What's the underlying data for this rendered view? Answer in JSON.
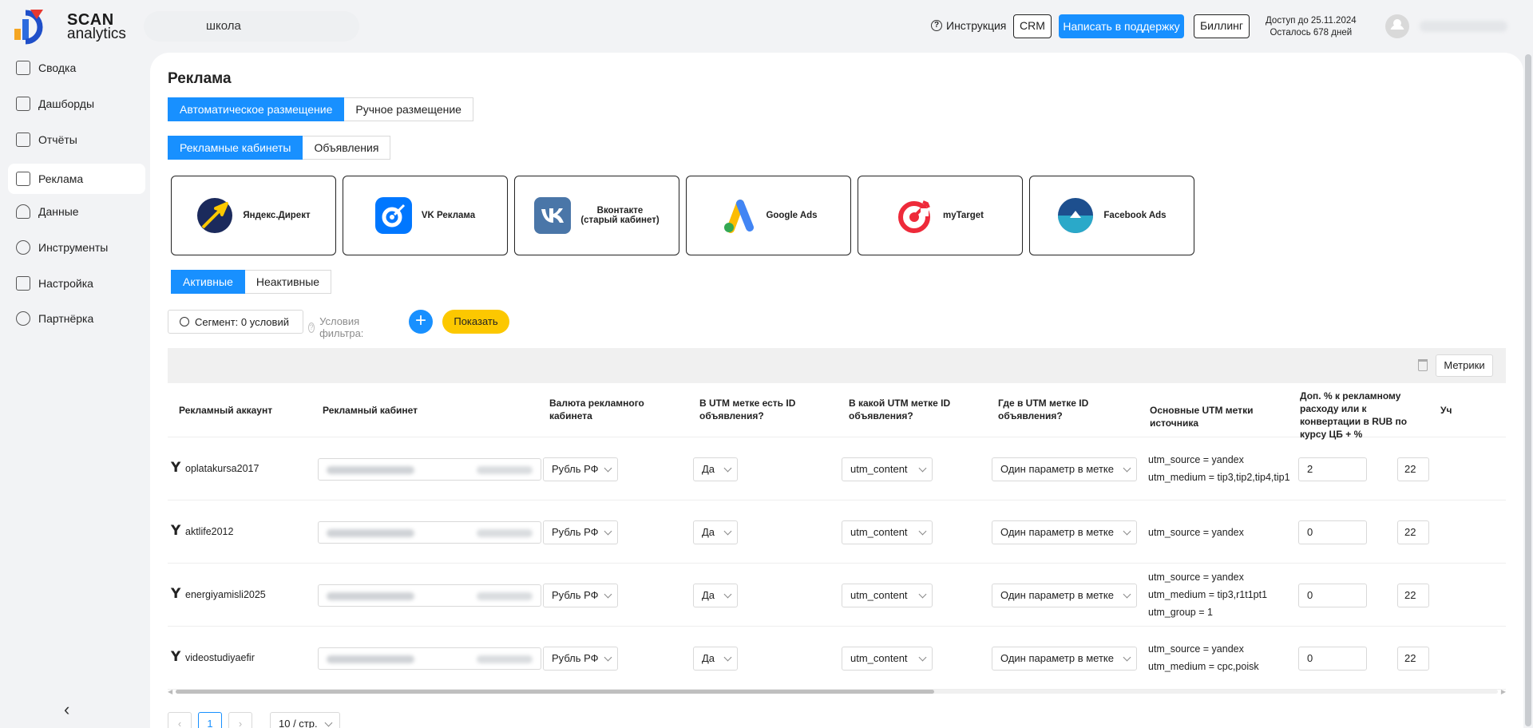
{
  "brand": {
    "line1": "SCAN",
    "line2": "analytics"
  },
  "project": {
    "name": "школа"
  },
  "header": {
    "help_label": "Инструкция",
    "crm_label": "CRM",
    "support_label": "Написать в поддержку",
    "billing_label": "Биллинг",
    "access_until": "Доступ до 25.11.2024",
    "days_left": "Осталось 678 дней"
  },
  "sidebar": {
    "items": [
      {
        "label": "Сводка",
        "icon": "summary-icon"
      },
      {
        "label": "Дашборды",
        "icon": "dashboard-icon"
      },
      {
        "label": "Отчёты",
        "icon": "reports-icon"
      },
      {
        "label": "Реклама",
        "icon": "ads-icon",
        "active": true
      },
      {
        "label": "Данные",
        "icon": "data-icon"
      },
      {
        "label": "Инструменты",
        "icon": "tools-icon"
      },
      {
        "label": "Настройка",
        "icon": "settings-icon"
      },
      {
        "label": "Партнёрка",
        "icon": "partners-icon"
      }
    ],
    "collapse_glyph": "‹"
  },
  "page": {
    "title": "Реклама",
    "placement_tabs": [
      "Автоматическое размещение",
      "Ручное размещение"
    ],
    "content_tabs": [
      "Рекламные кабинеты",
      "Объявления"
    ],
    "status_tabs": [
      "Активные",
      "Неактивные"
    ]
  },
  "platforms": [
    {
      "label": "Яндекс.Директ",
      "icon": "yandex-direct-icon"
    },
    {
      "label": "VK Реклама",
      "icon": "vk-ads-icon"
    },
    {
      "label": "Вконтакте\n(старый кабинет)",
      "icon": "vkontakte-icon"
    },
    {
      "label": "Google Ads",
      "icon": "google-ads-icon"
    },
    {
      "label": "myTarget",
      "icon": "mytarget-icon"
    },
    {
      "label": "Facebook Ads",
      "icon": "facebook-ads-icon"
    }
  ],
  "filters": {
    "segment_label": "Сегмент: 0 условий",
    "conditions_label": "Условия фильтра:",
    "add_glyph": "+",
    "show_label": "Показать"
  },
  "table": {
    "metrics_label": "Метрики",
    "columns": [
      "Рекламный аккаунт",
      "Рекламный кабинет",
      "Валюта рекламного кабинета",
      "В UTM метке есть ID объявления?",
      "В какой UTM метке ID объявления?",
      "Где в UTM метке ID объявления?",
      "Основные UTM метки источника",
      "Доп. % к рекламному расходу или к конвертации в RUB по курсу ЦБ + %",
      "Уч"
    ],
    "rows": [
      {
        "account": "oplatakursa2017",
        "currency": "Рубль РФ",
        "has_id": "Да",
        "utm_key": "utm_content",
        "where": "Один параметр в метке",
        "utm": [
          "utm_source = yandex",
          "utm_medium = tip3,tip2,tip4,tip1"
        ],
        "percent": "2",
        "cut": "22"
      },
      {
        "account": "aktlife2012",
        "currency": "Рубль РФ",
        "has_id": "Да",
        "utm_key": "utm_content",
        "where": "Один параметр в метке",
        "utm": [
          "utm_source = yandex"
        ],
        "percent": "0",
        "cut": "22"
      },
      {
        "account": "energiyamisli2025",
        "currency": "Рубль РФ",
        "has_id": "Да",
        "utm_key": "utm_content",
        "where": "Один параметр в метке",
        "utm": [
          "utm_source = yandex",
          "utm_medium = tip3,r1t1pt1",
          "utm_group = 1"
        ],
        "percent": "0",
        "cut": "22"
      },
      {
        "account": "videostudiyaefir",
        "currency": "Рубль РФ",
        "has_id": "Да",
        "utm_key": "utm_content",
        "where": "Один параметр в метке",
        "utm": [
          "utm_source = yandex",
          "utm_medium = cpc,poisk"
        ],
        "percent": "0",
        "cut": "22"
      }
    ]
  },
  "pagination": {
    "prev": "‹",
    "current": "1",
    "next": "›",
    "page_size": "10 / стр."
  },
  "colors": {
    "accent": "#1890ff",
    "show_button": "#fcc800"
  }
}
